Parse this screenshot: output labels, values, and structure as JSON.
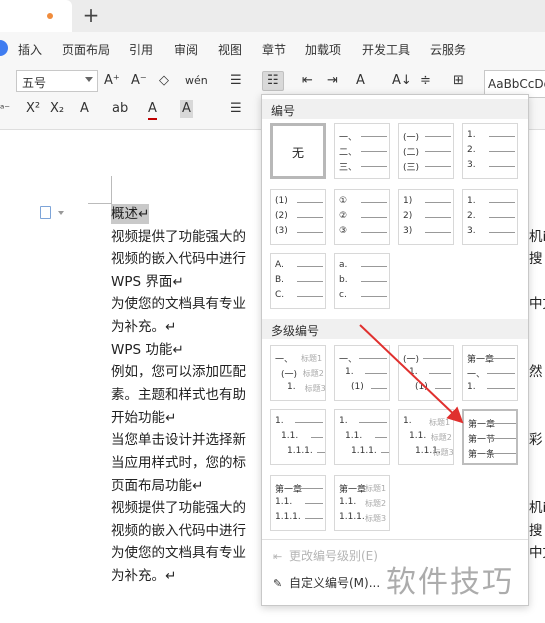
{
  "tabbar": {
    "new_tab": "+"
  },
  "menu": {
    "items": [
      "插入",
      "页面布局",
      "引用",
      "审阅",
      "视图",
      "章节",
      "加载项",
      "开发工具",
      "云服务"
    ]
  },
  "ribbon": {
    "font_size": "五号",
    "grow_font": "A⁺",
    "shrink_font": "A⁻",
    "eraser": "◇",
    "pinyin": "wén",
    "superscript": "X²",
    "subscript": "X₂",
    "text_effect": "A",
    "highlight": "ab",
    "font_color": "A",
    "char_shading": "A",
    "bullets": "☰",
    "numbering": "☷",
    "outdent": "⇤",
    "indent": "⇥",
    "text_direction": "A",
    "sort": "A↓",
    "line_spacing": "≑",
    "borders": "⊞",
    "style_preview": "AaBbCcDd",
    "align_left": "☰",
    "font_color_bar": "#c00000"
  },
  "document": {
    "lines": [
      "概述↵",
      "视频提供了功能强大的",
      "视频的嵌入代码中进行",
      "WPS 界面↵",
      "为使您的文档具有专业",
      "为补充。↵",
      "WPS 功能↵",
      "例如，您可以添加匹配",
      "素。主题和样式也有助",
      "开始功能↵",
      "当您单击设计并选择新",
      "当应用样式时，您的标",
      "页面布局功能↵",
      "视频提供了功能强大的",
      "视频的嵌入代码中进行",
      "为使您的文档具有专业",
      "为补充。↵"
    ],
    "right_edge": [
      "机i",
      "搜",
      "中文",
      "然",
      "彩",
      "机i",
      "搜",
      "中文"
    ]
  },
  "dropdown": {
    "section_numbering": "编号",
    "section_multilevel": "多级编号",
    "none_label": "无",
    "numbering_cells": [
      [
        "一、",
        "二、",
        "三、"
      ],
      [
        "(一)",
        "(二)",
        "(三)"
      ],
      [
        "1.",
        "2.",
        "3."
      ],
      [
        "(1)",
        "(2)",
        "(3)"
      ],
      [
        "①",
        "②",
        "③"
      ],
      [
        "1)",
        "2)",
        "3)"
      ],
      [
        "1.",
        "2.",
        "3."
      ],
      [
        "A.",
        "B.",
        "C."
      ],
      [
        "a.",
        "b.",
        "c."
      ]
    ],
    "multilevel_cells": [
      [
        [
          "一、",
          "标题1"
        ],
        [
          "(一)",
          "标题2"
        ],
        [
          "1.",
          "标题3"
        ]
      ],
      [
        [
          "一、",
          ""
        ],
        [
          "1.",
          ""
        ],
        [
          "(1)",
          ""
        ]
      ],
      [
        [
          "(一)",
          ""
        ],
        [
          "1.",
          ""
        ],
        [
          "(1)",
          ""
        ]
      ],
      [
        [
          "第一章",
          ""
        ],
        [
          "一、",
          ""
        ],
        [
          "1.",
          ""
        ]
      ],
      [
        [
          "1.",
          ""
        ],
        [
          "1.1.",
          ""
        ],
        [
          "1.1.1.",
          ""
        ]
      ],
      [
        [
          "1.",
          ""
        ],
        [
          "1.1.",
          ""
        ],
        [
          "1.1.1.",
          ""
        ]
      ],
      [
        [
          "1.",
          "标题1"
        ],
        [
          "1.1.",
          "标题2"
        ],
        [
          "1.1.1.",
          "标题3"
        ]
      ],
      [
        [
          "第一章",
          ""
        ],
        [
          "第一节",
          ""
        ],
        [
          "第一条",
          ""
        ]
      ],
      [
        [
          "第一章",
          ""
        ],
        [
          "1.1.",
          ""
        ],
        [
          "1.1.1.",
          ""
        ]
      ],
      [
        [
          "第一章",
          "标题1"
        ],
        [
          "1.1.",
          "标题2"
        ],
        [
          "1.1.1.",
          "标题3"
        ]
      ]
    ],
    "change_level": "更改编号级别(E)",
    "custom_numbering": "自定义编号(M)..."
  },
  "watermark": "软件技巧",
  "colors": {
    "accent": "#3f7cf0",
    "arrow": "#e0302e",
    "tab_dot": "#f08c3c"
  }
}
